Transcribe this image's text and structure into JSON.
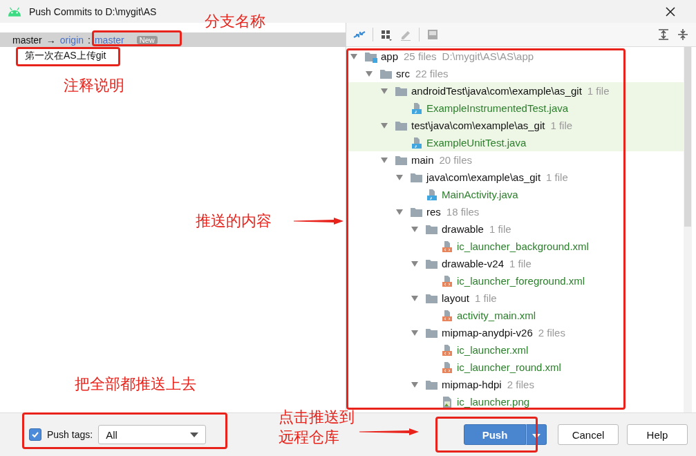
{
  "window": {
    "title": "Push Commits to D:\\mygit\\AS"
  },
  "branch": {
    "local": "master",
    "arrow": "→",
    "remote": "origin",
    "separator": ":",
    "remote_branch": "master",
    "badge": "New"
  },
  "commits": [
    {
      "message": "第一次在AS上传git"
    }
  ],
  "tree": [
    {
      "name": "app",
      "count": "25 files",
      "path": "D:\\mygit\\AS\\AS\\app",
      "kind": "module",
      "expanded": true,
      "highlighted": false,
      "children": [
        {
          "name": "src",
          "count": "22 files",
          "kind": "folder",
          "expanded": true,
          "highlighted": false,
          "children": [
            {
              "name": "androidTest\\java\\com\\example\\as_git",
              "count": "1 file",
              "kind": "folder",
              "expanded": true,
              "highlighted": true,
              "children": [
                {
                  "name": "ExampleInstrumentedTest.java",
                  "kind": "java",
                  "highlighted": true
                }
              ]
            },
            {
              "name": "test\\java\\com\\example\\as_git",
              "count": "1 file",
              "kind": "folder",
              "expanded": true,
              "highlighted": true,
              "children": [
                {
                  "name": "ExampleUnitTest.java",
                  "kind": "java",
                  "highlighted": true
                }
              ]
            },
            {
              "name": "main",
              "count": "20 files",
              "kind": "folder",
              "expanded": true,
              "highlighted": false,
              "children": [
                {
                  "name": "java\\com\\example\\as_git",
                  "count": "1 file",
                  "kind": "folder",
                  "expanded": true,
                  "highlighted": false,
                  "children": [
                    {
                      "name": "MainActivity.java",
                      "kind": "java",
                      "highlighted": false
                    }
                  ]
                },
                {
                  "name": "res",
                  "count": "18 files",
                  "kind": "folder",
                  "expanded": true,
                  "highlighted": false,
                  "children": [
                    {
                      "name": "drawable",
                      "count": "1 file",
                      "kind": "folder",
                      "expanded": true,
                      "highlighted": false,
                      "children": [
                        {
                          "name": "ic_launcher_background.xml",
                          "kind": "xml",
                          "highlighted": false
                        }
                      ]
                    },
                    {
                      "name": "drawable-v24",
                      "count": "1 file",
                      "kind": "folder",
                      "expanded": true,
                      "highlighted": false,
                      "children": [
                        {
                          "name": "ic_launcher_foreground.xml",
                          "kind": "xml",
                          "highlighted": false
                        }
                      ]
                    },
                    {
                      "name": "layout",
                      "count": "1 file",
                      "kind": "folder",
                      "expanded": true,
                      "highlighted": false,
                      "children": [
                        {
                          "name": "activity_main.xml",
                          "kind": "xml",
                          "highlighted": false
                        }
                      ]
                    },
                    {
                      "name": "mipmap-anydpi-v26",
                      "count": "2 files",
                      "kind": "folder",
                      "expanded": true,
                      "highlighted": false,
                      "children": [
                        {
                          "name": "ic_launcher.xml",
                          "kind": "xml",
                          "highlighted": false
                        },
                        {
                          "name": "ic_launcher_round.xml",
                          "kind": "xml",
                          "highlighted": false
                        }
                      ]
                    },
                    {
                      "name": "mipmap-hdpi",
                      "count": "2 files",
                      "kind": "folder",
                      "expanded": true,
                      "highlighted": false,
                      "children": [
                        {
                          "name": "ic_launcher.png",
                          "kind": "png",
                          "highlighted": false
                        }
                      ]
                    }
                  ]
                }
              ]
            }
          ]
        }
      ]
    }
  ],
  "footer": {
    "push_tags": {
      "label": "Push tags:",
      "checked": true,
      "value": "All"
    },
    "buttons": [
      {
        "label": "Push",
        "kind": "primary"
      },
      {
        "label": "Cancel",
        "kind": "normal"
      },
      {
        "label": "Help",
        "kind": "normal"
      }
    ]
  },
  "annotations": [
    {
      "text": "分支名称"
    },
    {
      "text": "注释说明"
    },
    {
      "text": "推送的内容"
    },
    {
      "text": "把全部都推送上去"
    },
    {
      "text": "点击推送到"
    },
    {
      "text": "远程仓库"
    }
  ]
}
